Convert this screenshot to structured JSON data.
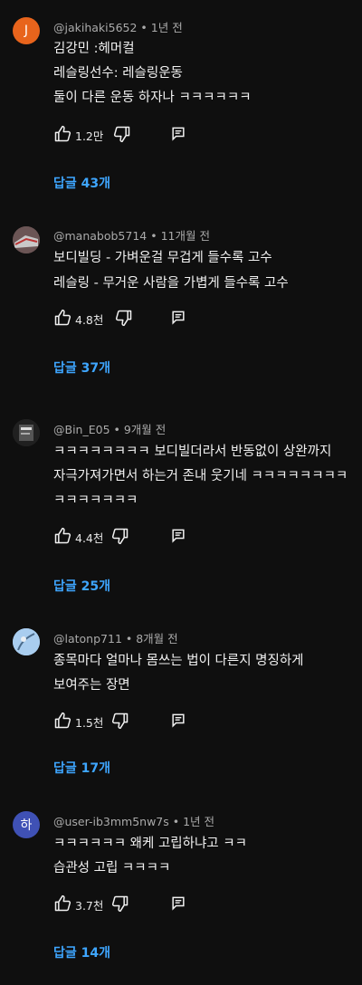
{
  "colors": {
    "background": "#0f0f0f",
    "link": "#3ea6ff",
    "text": "#f1f1f1",
    "meta": "#aaaaaa"
  },
  "comments": [
    {
      "username": "@jakihaki5652",
      "time": "1년 전",
      "avatar_letter": "J",
      "lines": [
        "김강민 :헤머컬",
        "레슬링선수: 레슬링운동",
        "둘이 다른 운동 하자나 ㅋㅋㅋㅋㅋㅋ"
      ],
      "likes": "1.2만",
      "replies": "답글 43개"
    },
    {
      "username": "@manabob5714",
      "time": "11개월 전",
      "lines": [
        "보디빌딩 - 가벼운걸 무겁게 들수록 고수",
        "레슬링 - 무거운 사람을 가볍게 들수록 고수"
      ],
      "likes": "4.8천",
      "replies": "답글 37개"
    },
    {
      "username": "@Bin_E05",
      "time": "9개월 전",
      "lines": [
        "ㅋㅋㅋㅋㅋㅋㅋㅋ 보디빌더라서 반동없이 상완까지",
        "자극가져가면서 하는거 존내 웃기네 ㅋㅋㅋㅋㅋㅋㅋㅋ",
        "ㅋㅋㅋㅋㅋㅋㅋ"
      ],
      "likes": "4.4천",
      "replies": "답글 25개"
    },
    {
      "username": "@latonp711",
      "time": "8개월 전",
      "lines": [
        "종목마다 얼마나 몸쓰는 법이 다른지  명징하게",
        "보여주는 장면"
      ],
      "likes": "1.5천",
      "replies": "답글 17개"
    },
    {
      "username": "@user-ib3mm5nw7s",
      "time": "1년 전",
      "avatar_letter": "하",
      "lines": [
        "ㅋㅋㅋㅋㅋㅋ 왜케 고립하냐고 ㅋㅋ",
        "습관성 고립 ㅋㅋㅋㅋ"
      ],
      "likes": "3.7천",
      "replies": "답글 14개"
    }
  ],
  "icons": {
    "like": "thumbs-up-icon",
    "dislike": "thumbs-down-icon",
    "reply": "reply-comment-icon"
  }
}
